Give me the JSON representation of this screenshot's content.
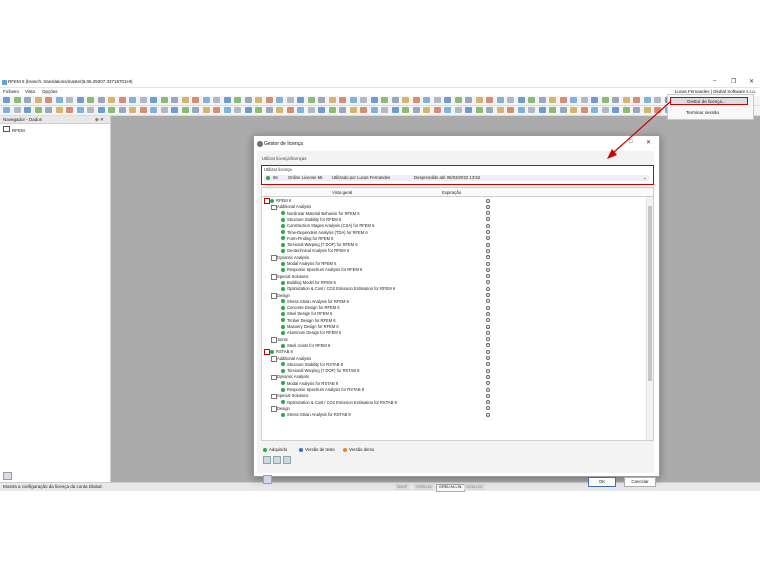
{
  "window": {
    "title": "RFEM 6 (branch: translations/master|6.06.25007.33718701HI)",
    "minimize_glyph": "–",
    "restore_glyph": "❐",
    "close_glyph": "✕"
  },
  "menubar": {
    "items": [
      "Ficheiro",
      "Vista",
      "Opções"
    ],
    "user": "Lucas Fernandes | Dlubal Software s.r.o."
  },
  "user_menu": {
    "items": [
      "Gestor de licença...",
      "Terminar sessão"
    ]
  },
  "navigator": {
    "title": "Navegador - Dados",
    "pin_close": "⊕ ✕",
    "item": "RFEM"
  },
  "statusbar": {
    "text": "Mostra a configuração da licença da conta Dlubal.",
    "buttons": [
      "SNAP",
      "GRELHA",
      "GRELHA LIN.",
      "GUIA LIN."
    ]
  },
  "dialog": {
    "title": "Gestor de licença",
    "used_licenses_label": "Utilizar licença/licenças",
    "license_box": {
      "title": "Utilizar licença",
      "id": "65",
      "name": "Online License 65",
      "used_by": "Utilizado por Lucas Fernandes",
      "expiration": "Desprendido até 05/03/2022 13:52"
    },
    "columns": {
      "overview": "Vista geral",
      "expiration": "Expiração"
    },
    "tree": [
      {
        "level": 0,
        "kind": "product",
        "label": "RFEM 6",
        "checkbox": true
      },
      {
        "level": 1,
        "kind": "group",
        "label": "Additional Analysis"
      },
      {
        "level": 2,
        "kind": "item",
        "label": "Nonlinear Material Behavior for RFEM 6"
      },
      {
        "level": 2,
        "kind": "item",
        "label": "Structure Stability for RFEM 6"
      },
      {
        "level": 2,
        "kind": "item",
        "label": "Construction Stages Analysis (CSA) for RFEM 6"
      },
      {
        "level": 2,
        "kind": "item",
        "label": "Time-Dependent Analysis (TDA) for RFEM 6"
      },
      {
        "level": 2,
        "kind": "item",
        "label": "Form-Finding for RFEM 6"
      },
      {
        "level": 2,
        "kind": "item",
        "label": "Torsional Warping (7 DOF) for RFEM 6"
      },
      {
        "level": 2,
        "kind": "item",
        "label": "Geotechnical Analysis for RFEM 6"
      },
      {
        "level": 1,
        "kind": "group",
        "label": "Dynamic Analysis"
      },
      {
        "level": 2,
        "kind": "item",
        "label": "Modal Analysis for RFEM 6"
      },
      {
        "level": 2,
        "kind": "item",
        "label": "Response Spectrum Analysis for RFEM 6"
      },
      {
        "level": 1,
        "kind": "group",
        "label": "Special Solutions"
      },
      {
        "level": 2,
        "kind": "item",
        "label": "Building Model for RFEM 6"
      },
      {
        "level": 2,
        "kind": "item",
        "label": "Optimization & Cost / CO2 Emission Estimation for RFEM 6"
      },
      {
        "level": 1,
        "kind": "group",
        "label": "Design"
      },
      {
        "level": 2,
        "kind": "item",
        "label": "Stress-Strain Analysis for RFEM 6"
      },
      {
        "level": 2,
        "kind": "item",
        "label": "Concrete Design for RFEM 6"
      },
      {
        "level": 2,
        "kind": "item",
        "label": "Steel Design for RFEM 6"
      },
      {
        "level": 2,
        "kind": "item",
        "label": "Timber Design for RFEM 6"
      },
      {
        "level": 2,
        "kind": "item",
        "label": "Masonry Design for RFEM 6"
      },
      {
        "level": 2,
        "kind": "item",
        "label": "Aluminum Design for RFEM 6"
      },
      {
        "level": 1,
        "kind": "group",
        "label": "Joints"
      },
      {
        "level": 2,
        "kind": "item",
        "label": "Steel Joints for RFEM 6"
      },
      {
        "level": 0,
        "kind": "product",
        "label": "RSTAB 9",
        "checkbox": true
      },
      {
        "level": 1,
        "kind": "group",
        "label": "Additional Analysis"
      },
      {
        "level": 2,
        "kind": "item",
        "label": "Structure Stability for RSTAB 9"
      },
      {
        "level": 2,
        "kind": "item",
        "label": "Torsional Warping (7 DOF) for RSTAB 9"
      },
      {
        "level": 1,
        "kind": "group",
        "label": "Dynamic Analysis"
      },
      {
        "level": 2,
        "kind": "item",
        "label": "Modal Analysis for RSTAB 9"
      },
      {
        "level": 2,
        "kind": "item",
        "label": "Response Spectrum Analysis for RSTAB 9"
      },
      {
        "level": 1,
        "kind": "group",
        "label": "Special Solutions"
      },
      {
        "level": 2,
        "kind": "item",
        "label": "Optimization & Cost / CO2 Emission Estimation for RSTAB 9"
      },
      {
        "level": 1,
        "kind": "group",
        "label": "Design"
      },
      {
        "level": 2,
        "kind": "item",
        "label": "Stress-Strain Analysis for RSTAB 9"
      }
    ],
    "legend": [
      {
        "label": "Adquirido",
        "color": "#2ea84a"
      },
      {
        "label": "Versão de teste",
        "color": "#2f6fd1"
      },
      {
        "label": "Versão demo",
        "color": "#f08020"
      }
    ],
    "ok_label": "OK",
    "cancel_label": "Cancelar"
  },
  "colors": {
    "highlight": "#cc0000",
    "workspace": "#ababab",
    "acquired": "#2ea84a"
  }
}
